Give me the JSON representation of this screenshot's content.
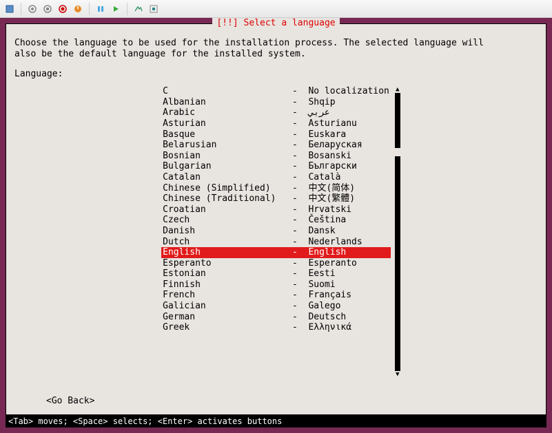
{
  "toolbar_icons": [
    "vbox-icon",
    "sep",
    "snapshot-take-icon",
    "snapshot-stop-icon",
    "snapshot-revert-icon",
    "power-off-icon",
    "sep",
    "pause-icon",
    "start-icon",
    "sep",
    "acpi-icon",
    "scale-icon"
  ],
  "dialog": {
    "title": "[!!] Select a language",
    "instruction": "Choose the language to be used for the installation process. The selected language will\nalso be the default language for the installed system.",
    "label": "Language:",
    "go_back": "<Go Back>"
  },
  "list": {
    "selected_index": 15,
    "items": [
      {
        "name": "C",
        "native": "No localization"
      },
      {
        "name": "Albanian",
        "native": "Shqip"
      },
      {
        "name": "Arabic",
        "native": "عربي"
      },
      {
        "name": "Asturian",
        "native": "Asturianu"
      },
      {
        "name": "Basque",
        "native": "Euskara"
      },
      {
        "name": "Belarusian",
        "native": "Беларуская"
      },
      {
        "name": "Bosnian",
        "native": "Bosanski"
      },
      {
        "name": "Bulgarian",
        "native": "Български"
      },
      {
        "name": "Catalan",
        "native": "Català"
      },
      {
        "name": "Chinese (Simplified)",
        "native": "中文(简体)"
      },
      {
        "name": "Chinese (Traditional)",
        "native": "中文(繁體)"
      },
      {
        "name": "Croatian",
        "native": "Hrvatski"
      },
      {
        "name": "Czech",
        "native": "Čeština"
      },
      {
        "name": "Danish",
        "native": "Dansk"
      },
      {
        "name": "Dutch",
        "native": "Nederlands"
      },
      {
        "name": "English",
        "native": "English"
      },
      {
        "name": "Esperanto",
        "native": "Esperanto"
      },
      {
        "name": "Estonian",
        "native": "Eesti"
      },
      {
        "name": "Finnish",
        "native": "Suomi"
      },
      {
        "name": "French",
        "native": "Français"
      },
      {
        "name": "Galician",
        "native": "Galego"
      },
      {
        "name": "German",
        "native": "Deutsch"
      },
      {
        "name": "Greek",
        "native": "Ελληνικά"
      }
    ]
  },
  "statusbar": "<Tab> moves; <Space> selects; <Enter> activates buttons",
  "colors": {
    "accent": "#772953",
    "highlight": "#e11b1b",
    "title": "#d00"
  }
}
